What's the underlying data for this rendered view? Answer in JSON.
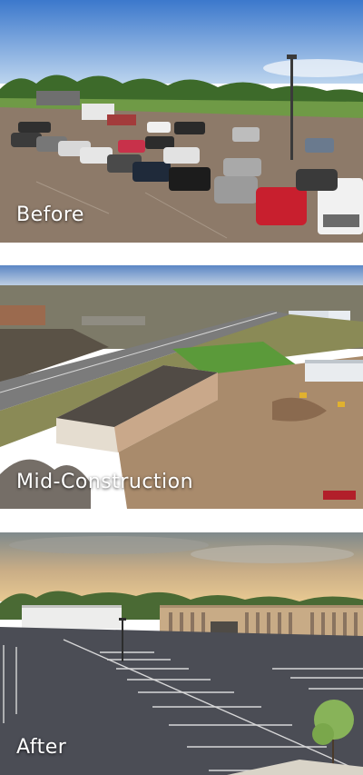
{
  "panels": [
    {
      "caption": "Before"
    },
    {
      "caption": "Mid-Construction"
    },
    {
      "caption": "After"
    }
  ],
  "colors": {
    "text": "#ffffff",
    "sky_day": "#4a86d6",
    "asphalt_before": "#8b7868",
    "asphalt_after": "#4a4c54",
    "dirt": "#a38466",
    "grass": "#5f8a3e",
    "sunset": "#e0b27a"
  }
}
